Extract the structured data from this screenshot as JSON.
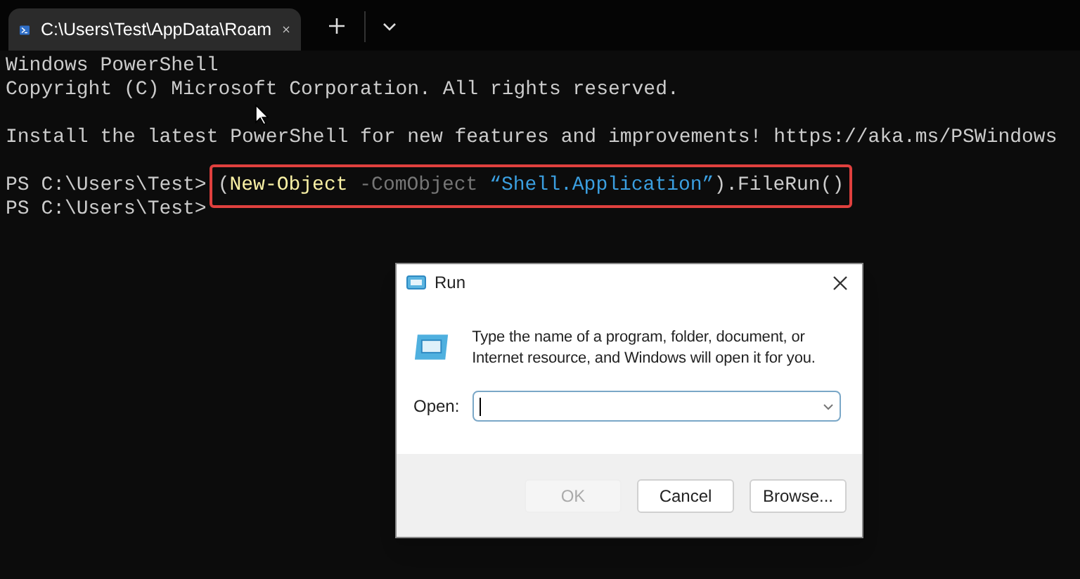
{
  "tab": {
    "title": "C:\\Users\\Test\\AppData\\Roam",
    "selected": true
  },
  "terminal": {
    "lines": [
      {
        "kind": "text",
        "text": "Windows PowerShell"
      },
      {
        "kind": "text",
        "text": "Copyright (C) Microsoft Corporation. All rights reserved."
      },
      {
        "kind": "blank"
      },
      {
        "kind": "text",
        "text": "Install the latest PowerShell for new features and improvements! https://aka.ms/PSWindows"
      },
      {
        "kind": "blank"
      },
      {
        "kind": "command",
        "prompt": "PS C:\\Users\\Test>",
        "highlighted": true,
        "segments": [
          {
            "kind": "plain",
            "text": "("
          },
          {
            "kind": "cmdlet",
            "text": "New-Object"
          },
          {
            "kind": "parameter",
            "text": "-ComObject"
          },
          {
            "kind": "string",
            "text": "“Shell.Application”"
          },
          {
            "kind": "plain",
            "text": ").FileRun()"
          }
        ]
      },
      {
        "kind": "command",
        "prompt": "PS C:\\Users\\Test>"
      }
    ]
  },
  "run_dialog": {
    "title": "Run",
    "message": "Type the name of a program, folder, document, or Internet resource, and Windows will open it for you.",
    "open_label": "Open:",
    "buttons": [
      {
        "label": "OK",
        "disabled": true
      },
      {
        "label": "Cancel",
        "disabled": false
      },
      {
        "label": "Browse...",
        "disabled": false
      }
    ]
  }
}
